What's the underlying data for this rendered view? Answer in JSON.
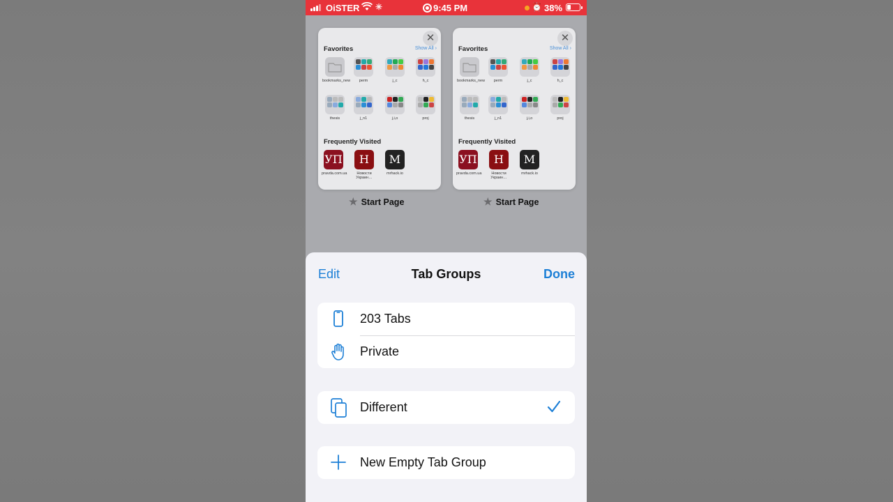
{
  "status": {
    "carrier": "OiSTER",
    "time": "9:45 PM",
    "battery": "38%"
  },
  "cards": [
    {
      "favorites_title": "Favorites",
      "show_all": "Show All",
      "tiles": [
        "bookmarks_new",
        "perm",
        "j_c",
        "h_c",
        "thesis",
        "j_n1",
        "j,i,o",
        "proj"
      ],
      "frequently_title": "Frequently Visited",
      "frequent": [
        {
          "glyph": "УП",
          "label": "pravda.com.ua",
          "color": "#8b1020"
        },
        {
          "glyph": "Н",
          "label": "Новости Украин…",
          "color": "#8a0f12"
        },
        {
          "glyph": "M",
          "label": "mrhack.io",
          "color": "#222222"
        }
      ],
      "caption": "Start Page"
    },
    {
      "favorites_title": "Favorites",
      "show_all": "Show All",
      "tiles": [
        "bookmarks_new",
        "perm",
        "j_c",
        "h_c",
        "thesis",
        "j_n1",
        "j,i,o",
        "proj"
      ],
      "frequently_title": "Frequently Visited",
      "frequent": [
        {
          "glyph": "УП",
          "label": "pravda.com.ua",
          "color": "#8b1020"
        },
        {
          "glyph": "Н",
          "label": "Новости Украин…",
          "color": "#8a0f12"
        },
        {
          "glyph": "M",
          "label": "mrhack.io",
          "color": "#222222"
        }
      ],
      "caption": "Start Page"
    }
  ],
  "sheet": {
    "edit": "Edit",
    "title": "Tab Groups",
    "done": "Done",
    "rows": {
      "tabs": "203 Tabs",
      "private": "Private",
      "different": "Different",
      "new_group": "New Empty Tab Group"
    }
  },
  "colors": {
    "accent": "#1c7fd6",
    "status_bar": "#e8333a"
  }
}
